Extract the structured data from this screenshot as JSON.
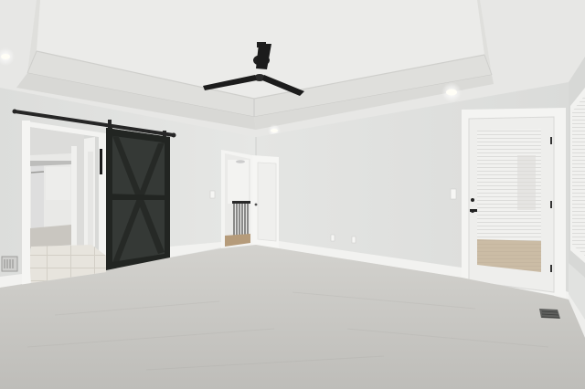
{
  "scene": {
    "colors": {
      "ceiling": "#e8e8e6",
      "ceiling_shadow": "#d6d6d3",
      "wall": "#e3e4e2",
      "wall_shadow": "#d5d6d4",
      "trim": "#f4f4f2",
      "carpet": "#c6c5c1",
      "carpet_far": "#d4d3cf",
      "barn_door": "#2c2f2c",
      "fan": "#1f1f1f",
      "light": "#fffdf2",
      "tile": "#e6e3dc",
      "blinds": "#f2f2f0"
    }
  }
}
